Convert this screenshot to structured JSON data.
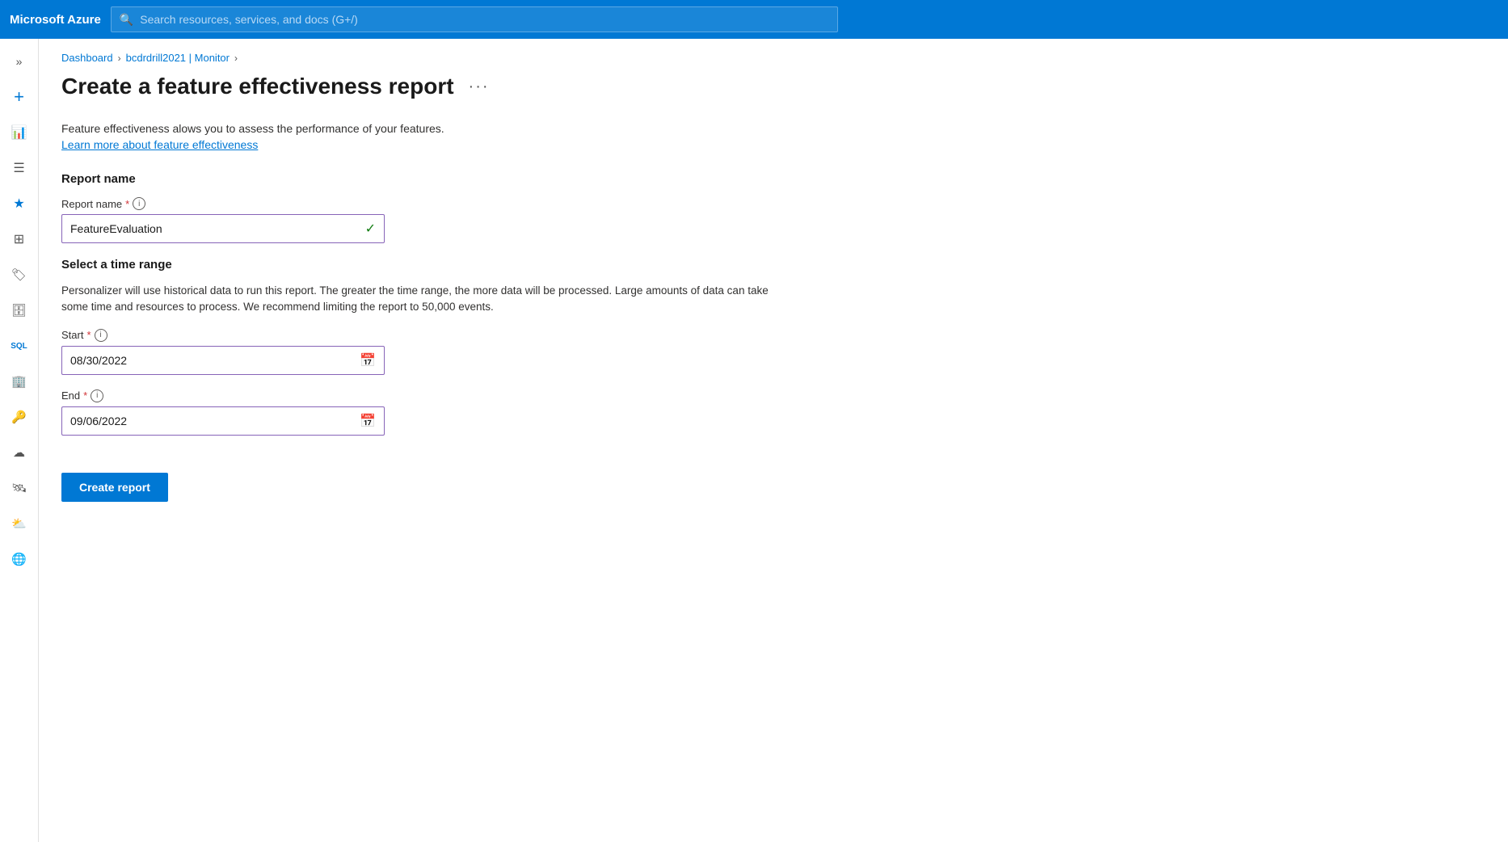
{
  "topbar": {
    "brand": "Microsoft Azure",
    "search_placeholder": "Search resources, services, and docs (G+/)"
  },
  "breadcrumb": {
    "items": [
      {
        "label": "Dashboard",
        "sep": ">"
      },
      {
        "label": "bcdrdrill2021 | Monitor",
        "sep": ">"
      }
    ]
  },
  "page": {
    "title": "Create a feature effectiveness report",
    "more_menu_label": "···",
    "description": "Feature effectiveness alows you to assess the performance of your features.",
    "learn_link": "Learn more about feature effectiveness"
  },
  "form": {
    "report_name_section_title": "Report name",
    "report_name_label": "Report name",
    "report_name_required": "*",
    "report_name_value": "FeatureEvaluation",
    "time_range_section_title": "Select a time range",
    "time_range_description": "Personalizer will use historical data to run this report. The greater the time range, the more data will be processed. Large amounts of data can take some time and resources to process. We recommend limiting the report to 50,000 events.",
    "start_label": "Start",
    "start_required": "*",
    "start_value": "08/30/2022",
    "end_label": "End",
    "end_required": "*",
    "end_value": "09/06/2022",
    "create_button_label": "Create report"
  },
  "sidebar": {
    "items": [
      {
        "name": "collapse-icon",
        "glyph": "»"
      },
      {
        "name": "add-icon",
        "glyph": "+"
      },
      {
        "name": "chart-icon",
        "glyph": "📊"
      },
      {
        "name": "list-icon",
        "glyph": "☰"
      },
      {
        "name": "favorites-icon",
        "glyph": "★"
      },
      {
        "name": "grid-icon",
        "glyph": "⊞"
      },
      {
        "name": "tag-icon",
        "glyph": "🏷"
      },
      {
        "name": "database-icon",
        "glyph": "🗄"
      },
      {
        "name": "sql-icon",
        "glyph": "SQL"
      },
      {
        "name": "building-icon",
        "glyph": "🏢"
      },
      {
        "name": "key-icon",
        "glyph": "🔑"
      },
      {
        "name": "cloud1-icon",
        "glyph": "☁"
      },
      {
        "name": "satellite-icon",
        "glyph": "🛰"
      },
      {
        "name": "cloud2-icon",
        "glyph": "⛅"
      },
      {
        "name": "cloud3-icon",
        "glyph": "🌐"
      }
    ]
  }
}
